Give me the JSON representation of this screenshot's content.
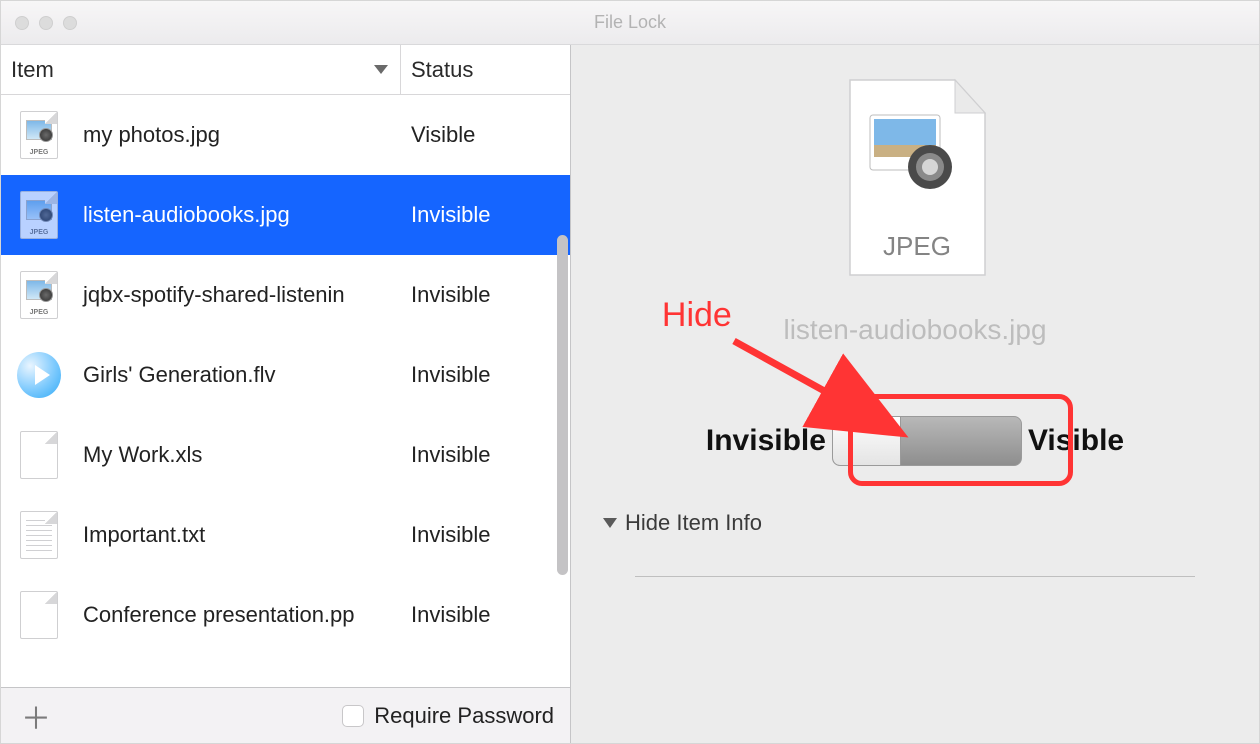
{
  "window": {
    "title": "File Lock"
  },
  "columns": {
    "item": "Item",
    "status": "Status"
  },
  "files": [
    {
      "name": "my photos.jpg",
      "status": "Visible",
      "kind": "jpeg",
      "selected": false
    },
    {
      "name": "listen-audiobooks.jpg",
      "status": "Invisible",
      "kind": "jpeg",
      "selected": true
    },
    {
      "name": "jqbx-spotify-shared-listenin",
      "status": "Invisible",
      "kind": "jpeg",
      "selected": false
    },
    {
      "name": "Girls' Generation.flv",
      "status": "Invisible",
      "kind": "video",
      "selected": false
    },
    {
      "name": "My Work.xls",
      "status": "Invisible",
      "kind": "xls",
      "selected": false
    },
    {
      "name": "Important.txt",
      "status": "Invisible",
      "kind": "txt",
      "selected": false
    },
    {
      "name": "Conference presentation.pp",
      "status": "Invisible",
      "kind": "ppt",
      "selected": false
    }
  ],
  "bottom": {
    "require_password": "Require Password"
  },
  "detail": {
    "filename": "listen-audiobooks.jpg",
    "icon_label": "JPEG",
    "toggle_left": "Invisible",
    "toggle_right": "Visible",
    "disclosure": "Hide Item Info"
  },
  "annotation": {
    "label": "Hide"
  }
}
